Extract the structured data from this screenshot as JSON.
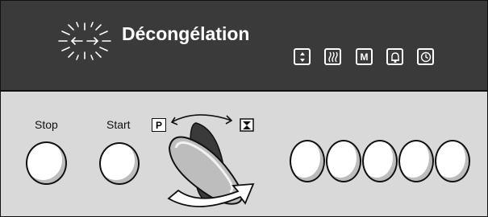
{
  "display": {
    "mode_title": "Décongélation",
    "mode_icon": "defrost-icon",
    "symbols": [
      {
        "name": "up-down-arrows-icon",
        "glyph": "▲▼"
      },
      {
        "name": "heat-waves-icon",
        "glyph": "§§§"
      },
      {
        "name": "memory-m-icon",
        "glyph": "M"
      },
      {
        "name": "bell-icon",
        "glyph": "🔔"
      },
      {
        "name": "clock-icon",
        "glyph": "◷"
      }
    ]
  },
  "controls": {
    "stop_label": "Stop",
    "start_label": "Start",
    "selector_left_symbol": "P",
    "selector_right_symbol": "hourglass-icon",
    "round_buttons_count": 5
  },
  "colors": {
    "display_bg": "#3a3a3a",
    "panel_bg": "#d9d9d9",
    "button_fill": "#ffffff",
    "outline": "#111111"
  }
}
